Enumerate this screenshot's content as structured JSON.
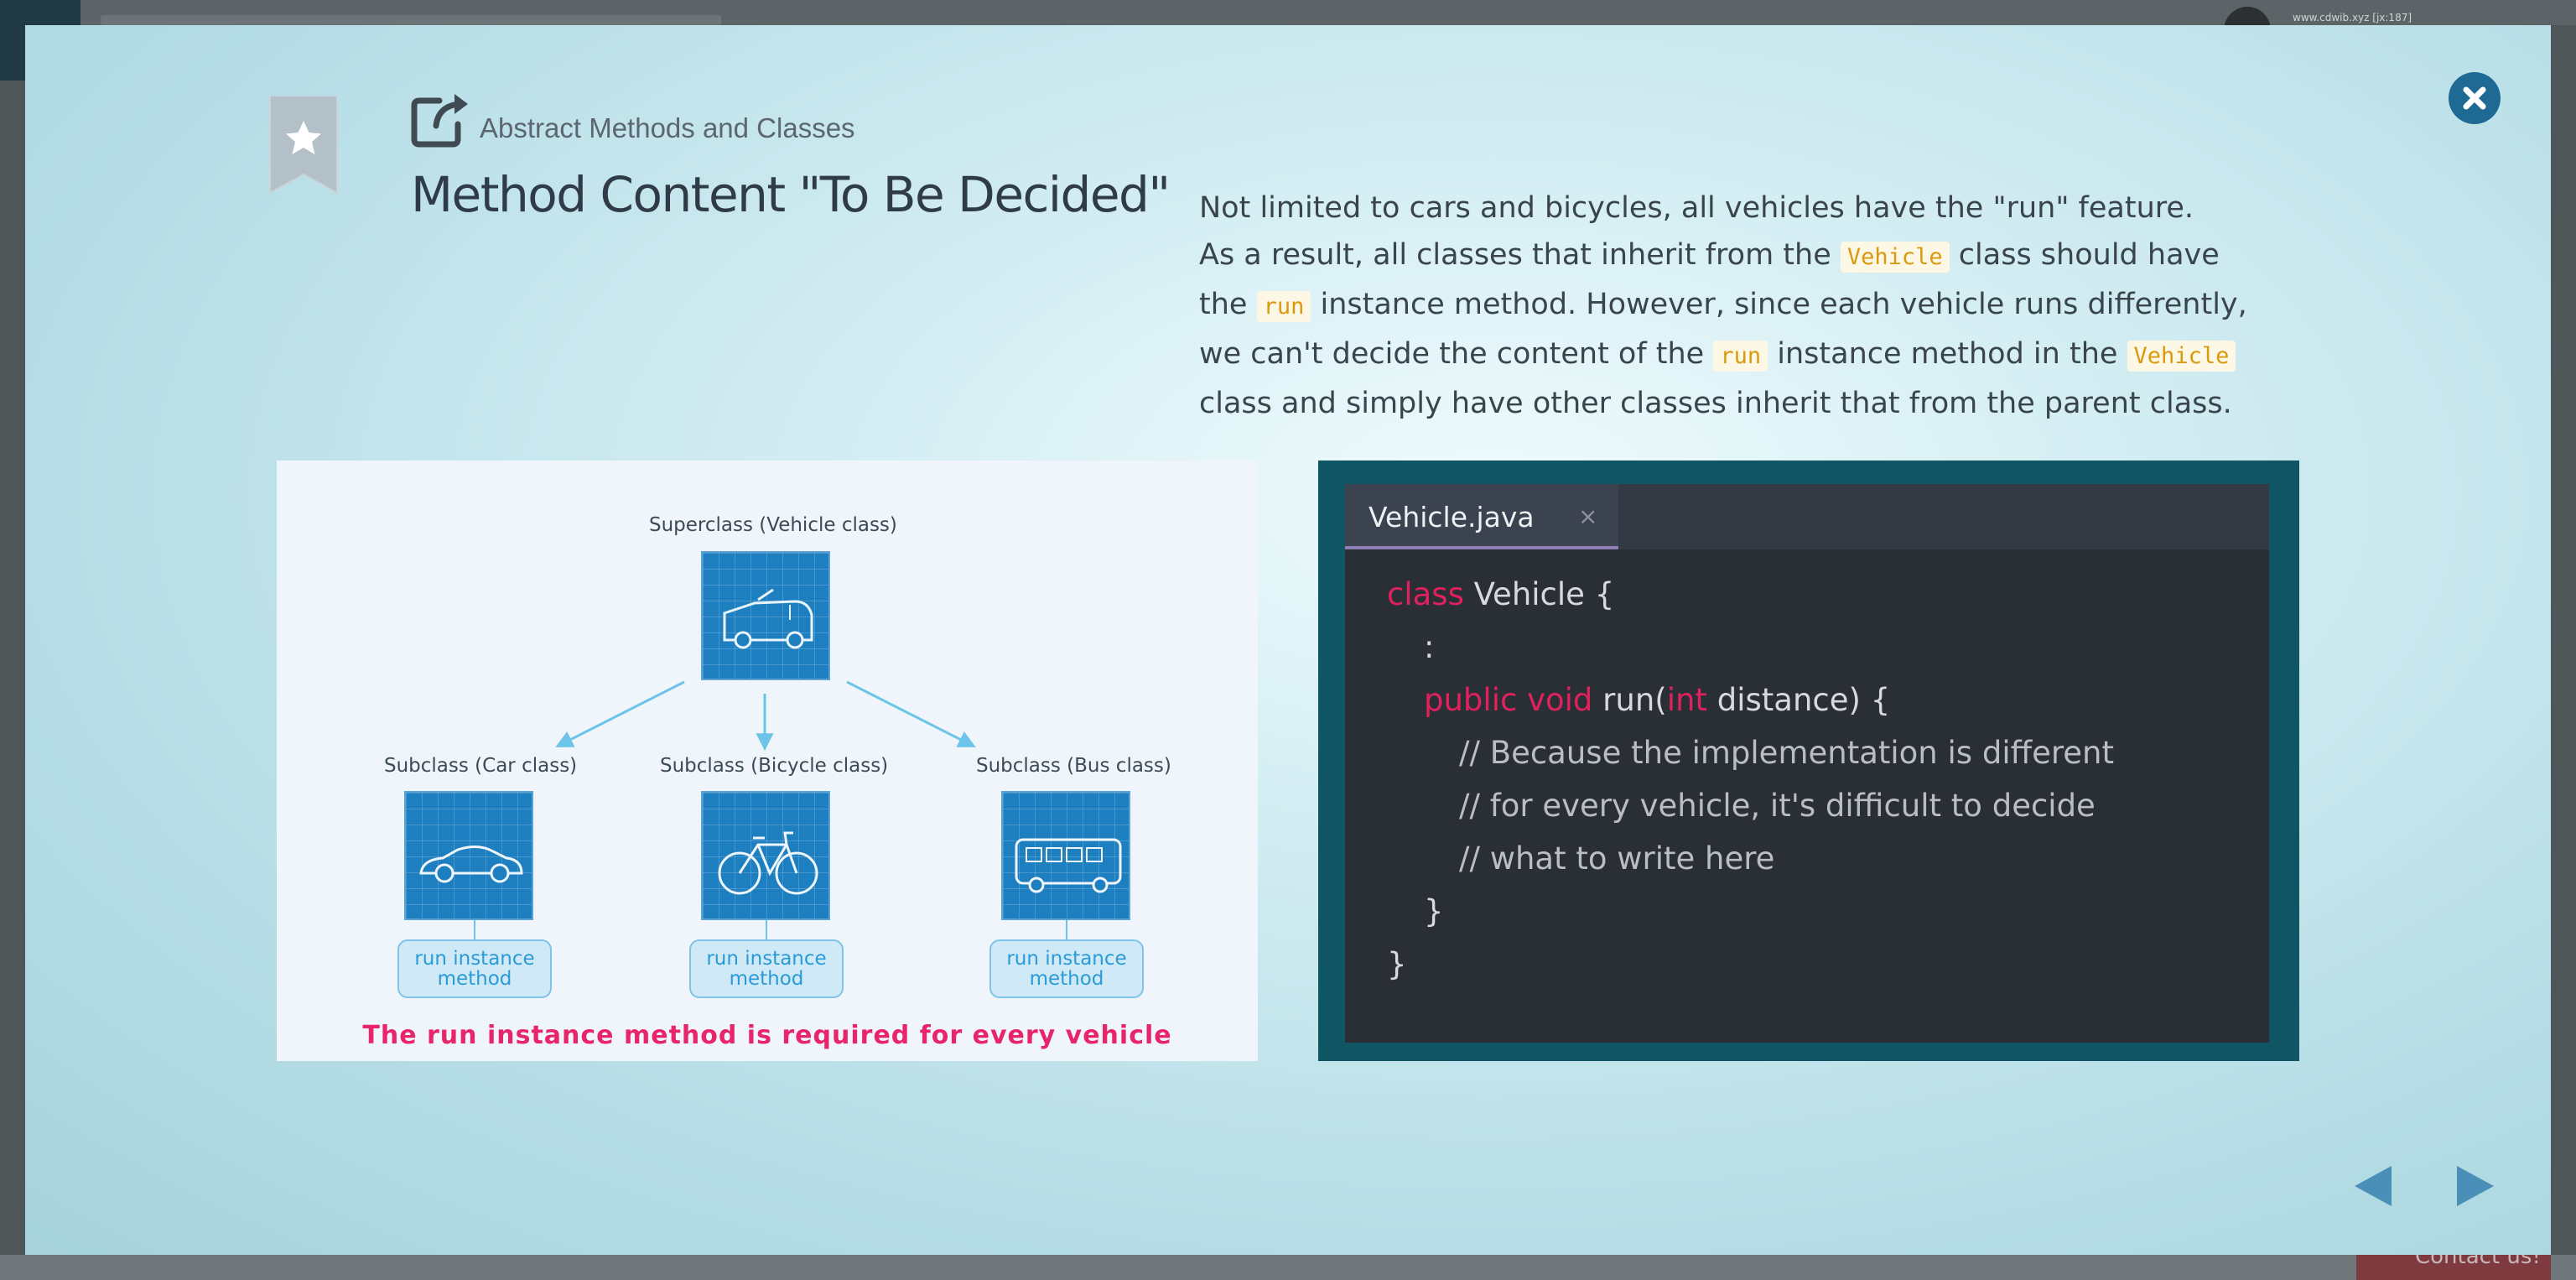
{
  "background_page": {
    "user_email": "www.cdwib.xyz [jx:187]",
    "contact_label": "Contact us!"
  },
  "modal": {
    "breadcrumb": "Abstract Methods and Classes",
    "title": "Method Content \"To Be Decided\"",
    "description": {
      "l1": "Not limited to cars and bicycles, all vehicles have the \"run\" feature.",
      "l2a": "As a result, all classes that inherit from the ",
      "c1": "Vehicle",
      "l2b": " class should have",
      "l3a": "the ",
      "c2": "run",
      "l3b": " instance method. However, since each vehicle runs differently,",
      "l4a": "we can't decide the content of the ",
      "c3": "run",
      "l4b": " instance method in the ",
      "c4": "Vehicle",
      "l5": "class and simply have other classes inherit that from the parent class."
    },
    "diagram": {
      "superclass_label": "Superclass (Vehicle class)",
      "subclasses": [
        {
          "label": "Subclass (Car class)",
          "method": [
            "run instance",
            "method"
          ]
        },
        {
          "label": "Subclass (Bicycle class)",
          "method": [
            "run instance",
            "method"
          ]
        },
        {
          "label": "Subclass (Bus class)",
          "method": [
            "run instance",
            "method"
          ]
        }
      ],
      "caption": "The run instance method is required for every vehicle"
    },
    "code": {
      "tab_name": "Vehicle.java",
      "tab_close": "×",
      "l1_kw": "class",
      "l1_rest": " Vehicle {",
      "l2": ":",
      "l3_kw": "public void",
      "l3_a": " run(",
      "l3_kw2": "int",
      "l3_b": " distance) {",
      "l4": "// Because the implementation is different",
      "l5": "// for every vehicle, it's difficult to decide",
      "l6": "// what to write here",
      "l7": "}",
      "l8": "}"
    }
  },
  "colors": {
    "accent": "#1e6a94",
    "keyword": "#e0215c",
    "caption": "#e8256a",
    "code_chip": "#d99a0e"
  },
  "icons": [
    "bookmark-star-icon",
    "external-link-icon",
    "close-icon",
    "prev-arrow-icon",
    "next-arrow-icon"
  ]
}
